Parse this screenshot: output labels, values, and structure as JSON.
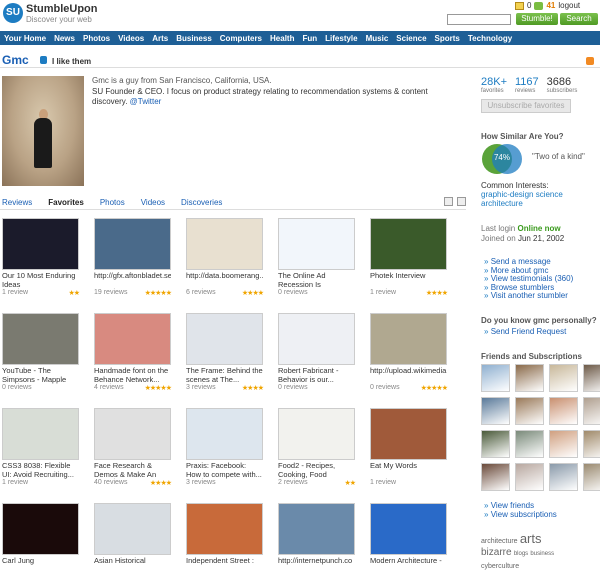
{
  "header": {
    "logo_mark": "SU",
    "logo_name": "StumbleUpon",
    "logo_tagline": "Discover your web",
    "mail_count": "0",
    "fav_count": "41",
    "logout": "logout",
    "search_placeholder": "",
    "stumble_label": "Stumble!",
    "search_label": "Search"
  },
  "nav": [
    "Your Home",
    "News",
    "Photos",
    "Videos",
    "Arts",
    "Business",
    "Computers",
    "Health",
    "Fun",
    "Lifestyle",
    "Music",
    "Science",
    "Sports",
    "Technology"
  ],
  "profile": {
    "name": "Gmc",
    "like_label": "I like them",
    "bio_line1": "Gmc is a guy from San Francisco, California, USA.",
    "bio_line2": "SU Founder & CEO. I focus on product strategy relating to recommendation systems & content discovery.",
    "twitter": "@Twitter"
  },
  "stats": [
    {
      "num": "28K+",
      "label": "favorites"
    },
    {
      "num": "1167",
      "label": "reviews"
    },
    {
      "num": "3686",
      "label": "subscribers"
    }
  ],
  "unsubscribe": "Unsubscribe favorites",
  "similar": {
    "heading": "How Similar Are You?",
    "percent": "74%",
    "caption": "\"Two of a kind\"",
    "common_heading": "Common Interests:",
    "common_values": "graphic-design  science architecture"
  },
  "status": {
    "last_login_label": "Last login",
    "last_login_value": "Online now",
    "joined_label": "Joined on",
    "joined_value": "Jun 21, 2002"
  },
  "actions": [
    "Send a message",
    "More about gmc",
    "View testimonials (360)",
    "Browse stumblers",
    "Visit another stumbler"
  ],
  "know": {
    "heading": "Do you know gmc personally?",
    "link": "Send Friend Request"
  },
  "friends": {
    "heading": "Friends and Subscriptions",
    "view_friends": "View friends",
    "view_subscriptions": "View subscriptions",
    "tiles": [
      "#8fb0d0",
      "#8a6a4a",
      "#c8b89a",
      "#6d5a48",
      "#5a7a9a",
      "#9a7a5a",
      "#c99070",
      "#b0a090",
      "#4a5a3a",
      "#7a8a7a",
      "#d0a080",
      "#a08a6a",
      "#6a4a3a",
      "#b8a8a0",
      "#8a9aaa",
      "#9a8a70"
    ]
  },
  "tags": {
    "t1": "architecture",
    "t2": "arts",
    "t3": "bizarre",
    "t4": "blogs",
    "t5": "business",
    "t6": "cyberculture"
  },
  "tabs": {
    "reviews": "Reviews",
    "favorites": "Favorites",
    "photos": "Photos",
    "videos": "Videos",
    "discoveries": "Discoveries"
  },
  "cards": [
    {
      "title": "Our 10 Most Enduring Ideas",
      "reviews": "1 review",
      "stars": "★★",
      "color": "#1b1b2b"
    },
    {
      "title": "http://gfx.aftonbladet.se/multimedia...",
      "reviews": "19 reviews",
      "stars": "★★★★★",
      "color": "#4a6a8a"
    },
    {
      "title": "http://data.boomerang.../b/boomerang...",
      "reviews": "6 reviews",
      "stars": "★★★★",
      "color": "#e8e0d0"
    },
    {
      "title": "The Online Ad Recession Is",
      "reviews": "0 reviews",
      "stars": "",
      "color": "#f2f6fb"
    },
    {
      "title": "Photek Interview",
      "reviews": "1 review",
      "stars": "★★★★",
      "color": "#3a5a2a"
    },
    {
      "title": "YouTube - The Simpsons - Mapple",
      "reviews": "0 reviews",
      "stars": "",
      "color": "#7a7a70"
    },
    {
      "title": "Handmade font on the Behance Network...",
      "reviews": "4 reviews",
      "stars": "★★★★★",
      "color": "#d88a80"
    },
    {
      "title": "The Frame: Behind the scenes at The...",
      "reviews": "3 reviews",
      "stars": "★★★★",
      "color": "#e0e4ea"
    },
    {
      "title": "Robert Fabricant - Behavior is our...",
      "reviews": "0 reviews",
      "stars": "",
      "color": "#eef0f4"
    },
    {
      "title": "http://upload.wikimedia.../wikipedia...",
      "reviews": "0 reviews",
      "stars": "★★★★★",
      "color": "#b0a890"
    },
    {
      "title": "CSS3 8038: Flexible UI: Avoid Recruiting...",
      "reviews": "1 review",
      "stars": "",
      "color": "#d8ddd6"
    },
    {
      "title": "Face Research & Demos & Make An",
      "reviews": "40 reviews",
      "stars": "★★★★",
      "color": "#e0e0e0"
    },
    {
      "title": "Praxis: Facebook: How to compete with...",
      "reviews": "3 reviews",
      "stars": "",
      "color": "#dde6ee"
    },
    {
      "title": "Food2 - Recipes, Cooking, Food",
      "reviews": "2 reviews",
      "stars": "★★",
      "color": "#f2f2ee"
    },
    {
      "title": "Eat My Words",
      "reviews": "1 review",
      "stars": "",
      "color": "#a05a3a"
    },
    {
      "title": "Carl Jung",
      "reviews": "",
      "stars": "",
      "color": "#1a0a0a"
    },
    {
      "title": "Asian Historical",
      "reviews": "",
      "stars": "",
      "color": "#d8dde2"
    },
    {
      "title": "Independent Street :",
      "reviews": "",
      "stars": "",
      "color": "#c86a3a"
    },
    {
      "title": "http://internetpunch.co",
      "reviews": "",
      "stars": "",
      "color": "#6a8aaa"
    },
    {
      "title": "Modern Architecture -",
      "reviews": "",
      "stars": "",
      "color": "#2a6ac8"
    }
  ]
}
